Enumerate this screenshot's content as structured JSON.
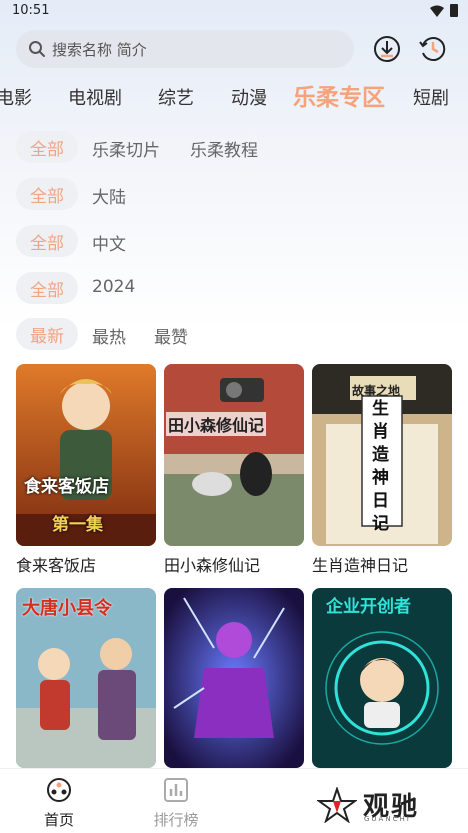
{
  "status_bar": {
    "time": "10:51"
  },
  "search": {
    "placeholder": "搜索名称 简介"
  },
  "tabs": [
    {
      "label": "电影"
    },
    {
      "label": "电视剧"
    },
    {
      "label": "综艺"
    },
    {
      "label": "动漫"
    },
    {
      "label": "乐柔专区",
      "active": true
    },
    {
      "label": "短剧"
    }
  ],
  "filters": [
    {
      "selected": "全部",
      "options": [
        "乐柔切片",
        "乐柔教程"
      ]
    },
    {
      "selected": "全部",
      "options": [
        "大陆"
      ]
    },
    {
      "selected": "全部",
      "options": [
        "中文"
      ]
    },
    {
      "selected": "全部",
      "options": [
        "2024"
      ]
    },
    {
      "selected": "最新",
      "options": [
        "最热",
        "最赞"
      ]
    }
  ],
  "cards": [
    {
      "title": "食来客饭店",
      "poster_text": "食来客饭店",
      "poster_sub": "第一集"
    },
    {
      "title": "田小森修仙记",
      "poster_text": "田小森修仙记"
    },
    {
      "title": "生肖造神日记",
      "poster_text": "生肖造神日记",
      "poster_sub": "故事之地"
    },
    {
      "title": "",
      "poster_text": "大唐小县令"
    },
    {
      "title": "",
      "poster_text": ""
    },
    {
      "title": "",
      "poster_text": "企业开创者"
    }
  ],
  "bottom_nav": [
    {
      "label": "首页",
      "active": true
    },
    {
      "label": "排行榜"
    }
  ],
  "watermark": {
    "text": "观驰",
    "sub": "GUANCHI"
  },
  "colors": {
    "accent": "#f6a37b",
    "chip_bg": "#eef0f4"
  }
}
